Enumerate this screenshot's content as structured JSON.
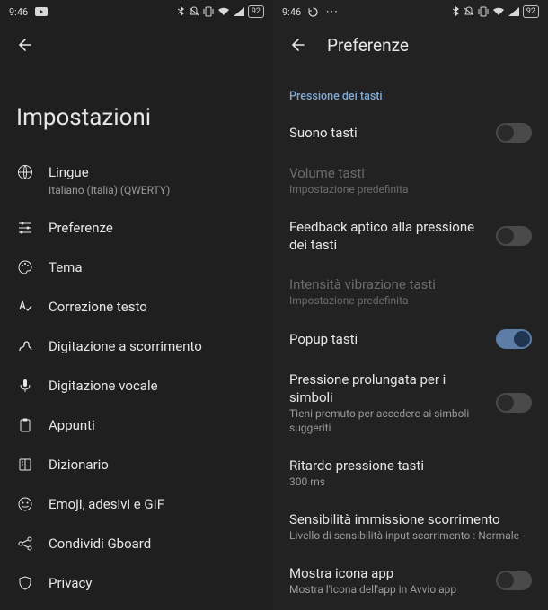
{
  "status": {
    "time": "9:46",
    "battery": "92"
  },
  "left": {
    "title": "Impostazioni",
    "items": [
      {
        "label": "Lingue",
        "sub": "Italiano (Italia) (QWERTY)"
      },
      {
        "label": "Preferenze"
      },
      {
        "label": "Tema"
      },
      {
        "label": "Correzione testo"
      },
      {
        "label": "Digitazione a scorrimento"
      },
      {
        "label": "Digitazione vocale"
      },
      {
        "label": "Appunti"
      },
      {
        "label": "Dizionario"
      },
      {
        "label": "Emoji, adesivi e GIF"
      },
      {
        "label": "Condividi Gboard"
      },
      {
        "label": "Privacy"
      }
    ]
  },
  "right": {
    "title": "Preferenze",
    "section": "Pressione dei tasti",
    "rows": {
      "sound": {
        "label": "Suono tasti"
      },
      "volume": {
        "label": "Volume tasti",
        "sub": "Impostazione predefinita"
      },
      "haptic": {
        "label": "Feedback aptico alla pressione dei tasti"
      },
      "vibration": {
        "label": "Intensità vibrazione tasti",
        "sub": "Impostazione predefinita"
      },
      "popup": {
        "label": "Popup tasti"
      },
      "longpress": {
        "label": "Pressione prolungata per i simboli",
        "sub": "Tieni premuto per accedere ai simboli suggeriti"
      },
      "delay": {
        "label": "Ritardo pressione tasti",
        "sub": "300 ms"
      },
      "sensitivity": {
        "label": "Sensibilità immissione scorrimento",
        "sub": "Livello di sensibilità input scorrimento : Normale"
      },
      "showicon": {
        "label": "Mostra icona app",
        "sub": "Mostra l'icona dell'app in Avvio app"
      }
    }
  }
}
